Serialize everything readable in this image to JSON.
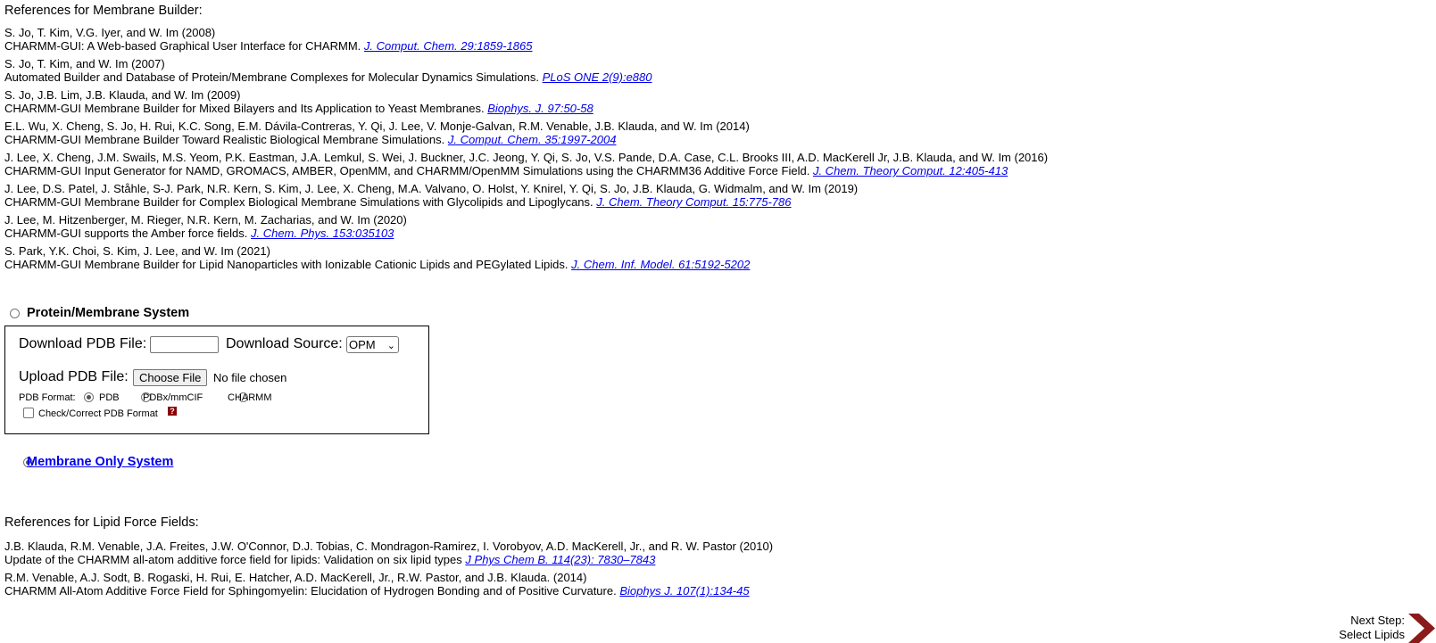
{
  "membrane_refs": {
    "heading": "References for Membrane Builder:",
    "items": [
      {
        "authors": "S. Jo, T. Kim, V.G. Iyer, and W. Im (2008)",
        "title": "CHARMM-GUI: A Web-based Graphical User Interface for CHARMM.",
        "link": "J. Comput. Chem. 29:1859-1865"
      },
      {
        "authors": "S. Jo, T. Kim, and W. Im (2007)",
        "title": "Automated Builder and Database of Protein/Membrane Complexes for Molecular Dynamics Simulations.",
        "link": "PLoS ONE 2(9):e880"
      },
      {
        "authors": "S. Jo, J.B. Lim, J.B. Klauda, and W. Im (2009)",
        "title": "CHARMM-GUI Membrane Builder for Mixed Bilayers and Its Application to Yeast Membranes.",
        "link": "Biophys. J. 97:50-58"
      },
      {
        "authors": "E.L. Wu, X. Cheng, S. Jo, H. Rui, K.C. Song, E.M. Dávila-Contreras, Y. Qi, J. Lee, V. Monje-Galvan, R.M. Venable, J.B. Klauda, and W. Im (2014)",
        "title": "CHARMM-GUI Membrane Builder Toward Realistic Biological Membrane Simulations.",
        "link": "J. Comput. Chem. 35:1997-2004"
      },
      {
        "authors": "J. Lee, X. Cheng, J.M. Swails, M.S. Yeom, P.K. Eastman, J.A. Lemkul, S. Wei, J. Buckner, J.C. Jeong, Y. Qi, S. Jo, V.S. Pande, D.A. Case, C.L. Brooks III, A.D. MacKerell Jr, J.B. Klauda, and W. Im (2016)",
        "title": "CHARMM-GUI Input Generator for NAMD, GROMACS, AMBER, OpenMM, and CHARMM/OpenMM Simulations using the CHARMM36 Additive Force Field.",
        "link": "J. Chem. Theory Comput. 12:405-413"
      },
      {
        "authors": "J. Lee, D.S. Patel, J. Ståhle, S-J. Park, N.R. Kern, S. Kim, J. Lee, X. Cheng, M.A. Valvano, O. Holst, Y. Knirel, Y. Qi, S. Jo, J.B. Klauda, G. Widmalm, and W. Im (2019)",
        "title": "CHARMM-GUI Membrane Builder for Complex Biological Membrane Simulations with Glycolipids and Lipoglycans.",
        "link": "J. Chem. Theory Comput. 15:775-786"
      },
      {
        "authors": "J. Lee, M. Hitzenberger, M. Rieger, N.R. Kern, M. Zacharias, and W. Im (2020)",
        "title": "CHARMM-GUI supports the Amber force fields.",
        "link": "J. Chem. Phys. 153:035103"
      },
      {
        "authors": "S. Park, Y.K. Choi, S. Kim, J. Lee, and W. Im (2021)",
        "title": "CHARMM-GUI Membrane Builder for Lipid Nanoparticles with Ionizable Cationic Lipids and PEGylated Lipids.",
        "link": "J. Chem. Inf. Model. 61:5192-5202"
      }
    ]
  },
  "protein_option": {
    "label": "Protein/Membrane System",
    "selected": false,
    "download_label": "Download PDB File:",
    "download_value": "",
    "source_label": "Download Source:",
    "source_value": "OPM",
    "upload_label": "Upload PDB File:",
    "choose_file": "Choose File",
    "no_file": "No file chosen",
    "format_label": "PDB Format:",
    "formats": [
      "PDB",
      "PDBx/mmCIF",
      "CHARMM"
    ],
    "selected_format": "PDB",
    "check_label": "Check/Correct PDB Format",
    "help_glyph": "?"
  },
  "membrane_option": {
    "label": "Membrane Only System",
    "selected": true
  },
  "lipid_refs": {
    "heading": "References for Lipid Force Fields:",
    "items": [
      {
        "authors": "J.B. Klauda, R.M. Venable, J.A. Freites, J.W. O'Connor, D.J. Tobias, C. Mondragon-Ramirez, I. Vorobyov, A.D. MacKerell, Jr., and R. W. Pastor (2010)",
        "title": "Update of the CHARMM all-atom additive force field for lipids: Validation on six lipid types",
        "link": "J Phys Chem B. 114(23): 7830–7843"
      },
      {
        "authors": "R.M. Venable, A.J. Sodt, B. Rogaski, H. Rui, E. Hatcher, A.D. MacKerell, Jr., R.W. Pastor, and J.B. Klauda. (2014)",
        "title": "CHARMM All-Atom Additive Force Field for Sphingomyelin: Elucidation of Hydrogen Bonding and of Positive Curvature.",
        "link": "Biophys J. 107(1):134-45"
      }
    ]
  },
  "next_step": {
    "line1": "Next Step:",
    "line2": "Select Lipids",
    "icon": "chevron-right-icon",
    "color": "#8b1a1a"
  }
}
